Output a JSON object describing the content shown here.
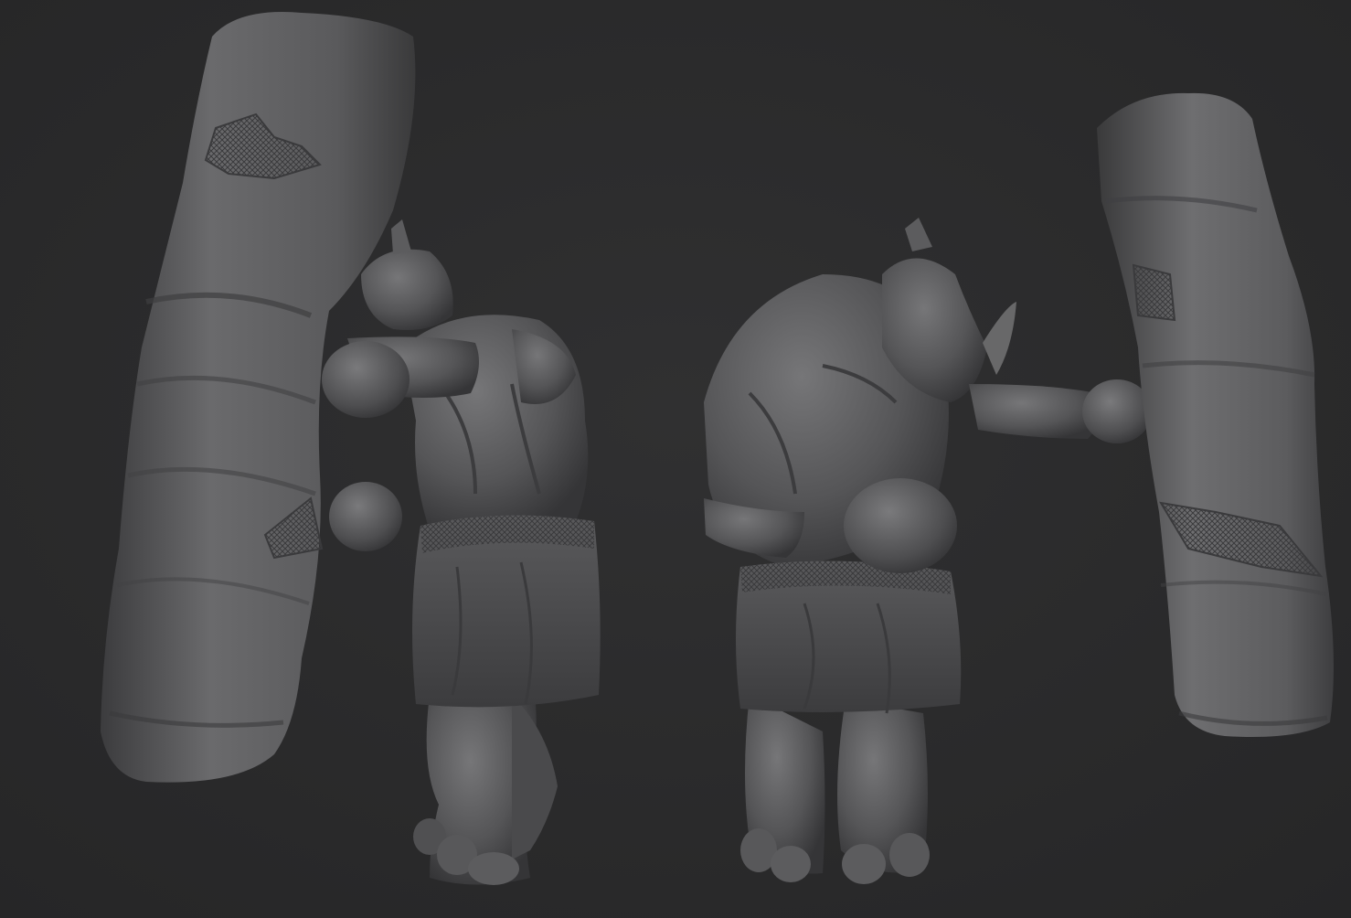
{
  "scene": {
    "background": "#2b2b2c",
    "clay_color": "#5a5a5c",
    "clay_highlight": "#7a7a7c",
    "clay_shadow": "#38383a",
    "subjects": [
      {
        "name": "punching-bag-left"
      },
      {
        "name": "rhino-boxer-back-view"
      },
      {
        "name": "rhino-boxer-front-view"
      },
      {
        "name": "punching-bag-right"
      }
    ]
  }
}
